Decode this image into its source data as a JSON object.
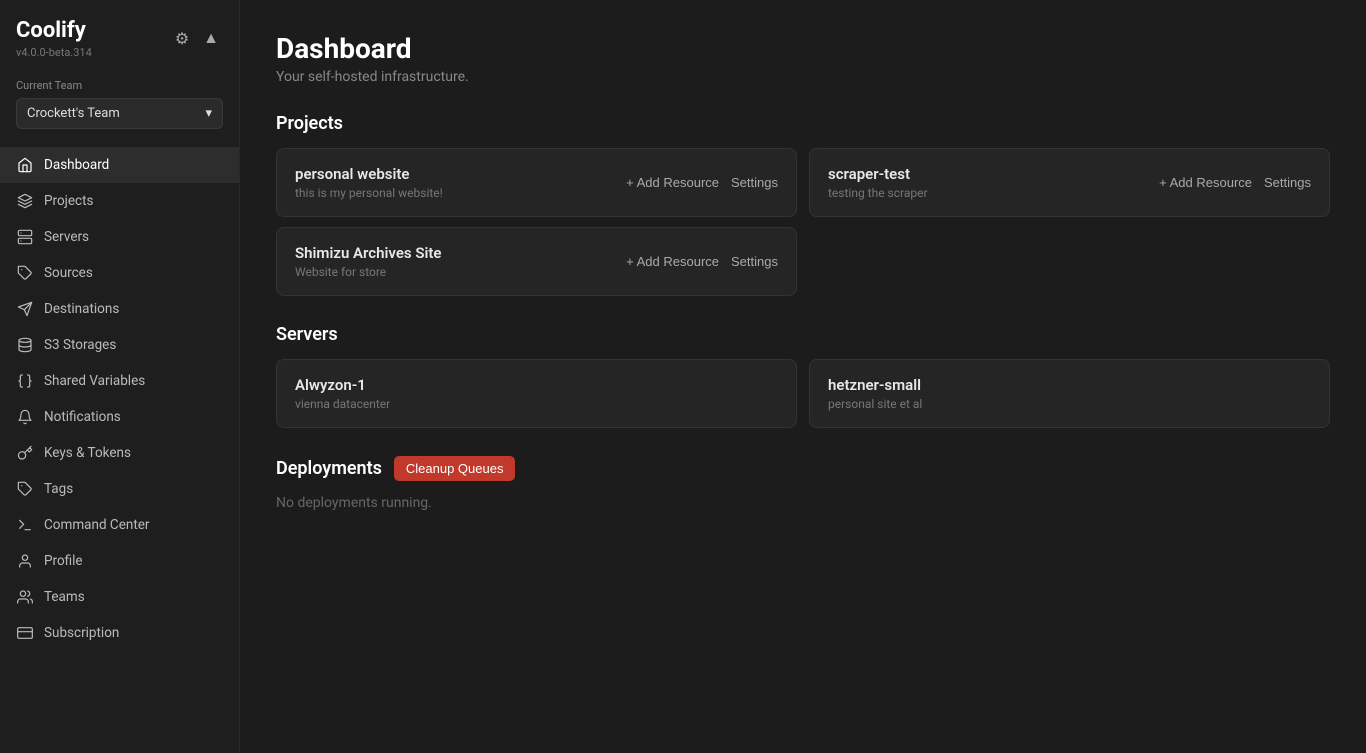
{
  "brand": {
    "name": "Coolify",
    "version": "v4.0.0-beta.314"
  },
  "current_team": {
    "label": "Current Team",
    "value": "Crockett's Team"
  },
  "sidebar": {
    "items": [
      {
        "id": "dashboard",
        "label": "Dashboard",
        "icon": "home",
        "active": true
      },
      {
        "id": "projects",
        "label": "Projects",
        "icon": "layers"
      },
      {
        "id": "servers",
        "label": "Servers",
        "icon": "server"
      },
      {
        "id": "sources",
        "label": "Sources",
        "icon": "tag"
      },
      {
        "id": "destinations",
        "label": "Destinations",
        "icon": "send"
      },
      {
        "id": "s3-storages",
        "label": "S3 Storages",
        "icon": "database"
      },
      {
        "id": "shared-variables",
        "label": "Shared Variables",
        "icon": "braces"
      },
      {
        "id": "notifications",
        "label": "Notifications",
        "icon": "bell"
      },
      {
        "id": "keys-tokens",
        "label": "Keys & Tokens",
        "icon": "key"
      },
      {
        "id": "tags",
        "label": "Tags",
        "icon": "tag2"
      },
      {
        "id": "command-center",
        "label": "Command Center",
        "icon": "terminal"
      },
      {
        "id": "profile",
        "label": "Profile",
        "icon": "user"
      },
      {
        "id": "teams",
        "label": "Teams",
        "icon": "users"
      },
      {
        "id": "subscription",
        "label": "Subscription",
        "icon": "credit-card"
      }
    ]
  },
  "dashboard": {
    "title": "Dashboard",
    "subtitle": "Your self-hosted infrastructure.",
    "projects_title": "Projects",
    "projects": [
      {
        "id": "personal-website",
        "name": "personal website",
        "desc": "this is my personal website!",
        "add_resource": "+ Add Resource",
        "settings": "Settings"
      },
      {
        "id": "scraper-test",
        "name": "scraper-test",
        "desc": "testing the scraper",
        "add_resource": "+ Add Resource",
        "settings": "Settings"
      },
      {
        "id": "shimizu-archives",
        "name": "Shimizu Archives Site",
        "desc": "Website for store",
        "add_resource": "+ Add Resource",
        "settings": "Settings"
      }
    ],
    "servers_title": "Servers",
    "servers": [
      {
        "id": "alwyzon-1",
        "name": "Alwyzon-1",
        "desc": "vienna datacenter"
      },
      {
        "id": "hetzner-small",
        "name": "hetzner-small",
        "desc": "personal site et al"
      }
    ],
    "deployments_title": "Deployments",
    "cleanup_queues_label": "Cleanup Queues",
    "no_deployments": "No deployments running."
  }
}
